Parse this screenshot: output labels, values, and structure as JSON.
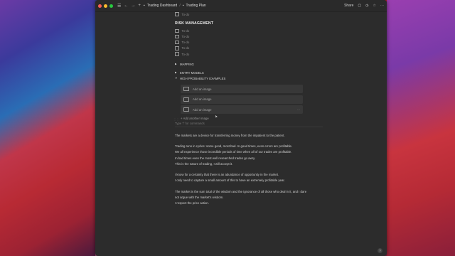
{
  "titlebar": {
    "share_label": "Share",
    "breadcrumbs": [
      {
        "label": "Trading Dashboard"
      },
      {
        "label": "Trading Plan"
      }
    ]
  },
  "todos_top": [
    "To-do"
  ],
  "risk_management": {
    "heading": "RISK MANAGEMENT",
    "todos": [
      "To-do",
      "To-do",
      "To-do",
      "To-do",
      "To-do"
    ]
  },
  "toggles": [
    {
      "label": "MAPPING",
      "expanded": false
    },
    {
      "label": "ENTRY MODELS",
      "expanded": false
    },
    {
      "label": "HIGH PROBABILITY EXAMPLES",
      "expanded": true
    }
  ],
  "images": [
    {
      "label": "Add an image"
    },
    {
      "label": "Add an image"
    },
    {
      "label": "Add an image"
    }
  ],
  "add_another_label": "+ Add another image",
  "comment_placeholder": "Type '/' for commands",
  "paragraphs": [
    [
      "The markets are a device for transferring money from the impatient to the patient."
    ],
    [
      "Trading runs in cycles: some good, most bad. In good times, even errors are profitable.",
      "We all experience those incredible periods of time when all of our trades are profitable.",
      "In bad times even the most well researched trades go awry.",
      "This is the nature of trading, I will accept it."
    ],
    [
      "I know for a certainty that there is an abundance of opportunity in the market.",
      "I only need to capture a small amount of this to have an extremely profitable year."
    ],
    [
      "The market is the sum total of the wisdom and the ignorance of all those who deal in it, and I dare",
      "not argue with the market's wisdom.",
      "I respect the price action."
    ]
  ],
  "help_label": "?",
  "colors": {
    "window_bg": "#2c2c2c",
    "block_bg": "#383838",
    "text": "#d6d6d6"
  }
}
